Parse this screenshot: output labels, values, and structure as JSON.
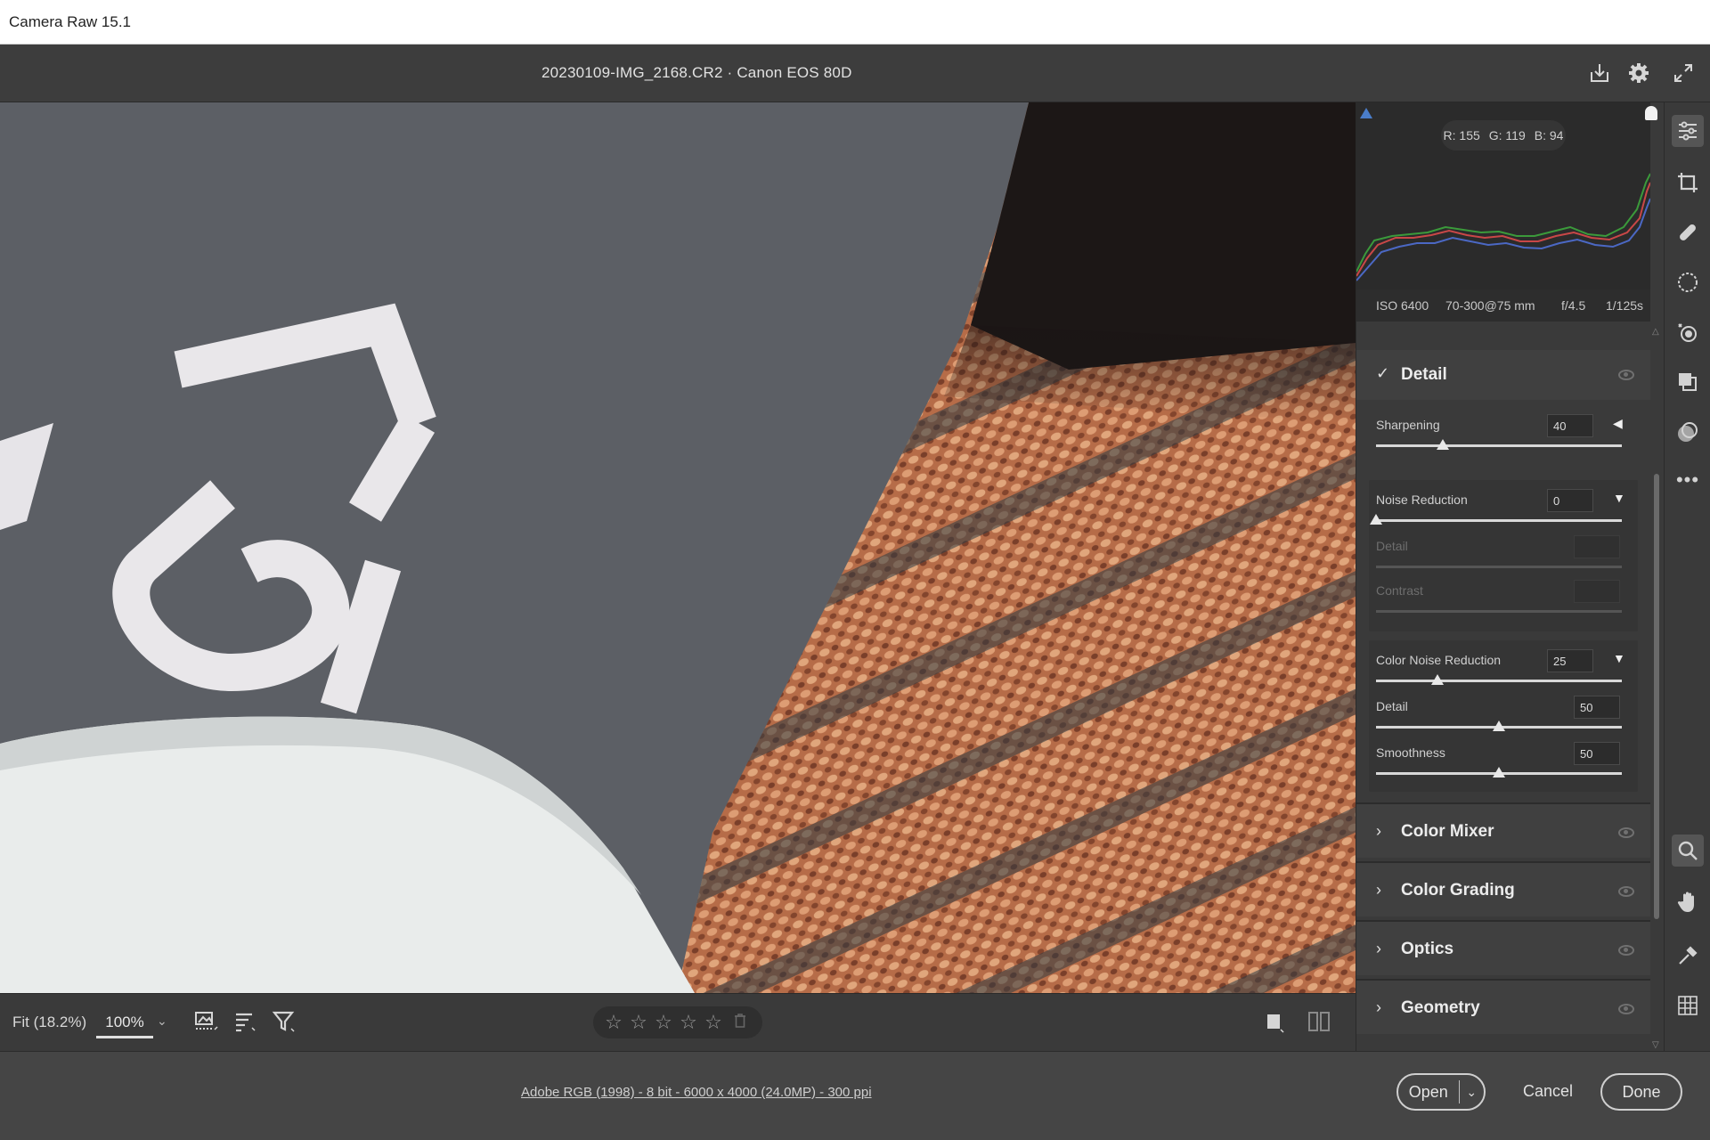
{
  "app": {
    "title": "Camera Raw 15.1"
  },
  "header": {
    "file_info": "20230109-IMG_2168.CR2  ·  Canon EOS 80D"
  },
  "histogram": {
    "readout": {
      "r": "R: 155",
      "g": "G: 119",
      "b": "B: 94"
    },
    "meta": {
      "iso": "ISO 6400",
      "lens": "70-300@75 mm",
      "aperture": "f/4.5",
      "shutter": "1/125s"
    }
  },
  "panels": {
    "detail": {
      "title": "Detail",
      "sharpening": {
        "label": "Sharpening",
        "value": "40",
        "fraction": 0.27
      },
      "noise_reduction": {
        "label": "Noise Reduction",
        "value": "0",
        "fraction": 0.0
      },
      "nr_detail": {
        "label": "Detail",
        "value": ""
      },
      "nr_contrast": {
        "label": "Contrast",
        "value": ""
      },
      "color_noise_reduction": {
        "label": "Color Noise Reduction",
        "value": "25",
        "fraction": 0.25
      },
      "cnr_detail": {
        "label": "Detail",
        "value": "50",
        "fraction": 0.5
      },
      "cnr_smoothness": {
        "label": "Smoothness",
        "value": "50",
        "fraction": 0.5
      }
    },
    "collapsed": [
      "Color Mixer",
      "Color Grading",
      "Optics",
      "Geometry"
    ]
  },
  "statusbar": {
    "zoom_fit": "Fit (18.2%)",
    "zoom_100": "100%",
    "stars": 5,
    "rating": 0
  },
  "footer": {
    "workflow": "Adobe RGB (1998) - 8 bit - 6000 x 4000 (24.0MP) - 300 ppi",
    "open": "Open",
    "cancel": "Cancel",
    "done": "Done"
  },
  "photo": {
    "visible_text": "15"
  },
  "colors": {
    "panel_bg": "#3a3a3a",
    "canvas_gray": "#5b5e63",
    "fabric": "#b46a47",
    "accent_blue": "#4a7dc9"
  }
}
